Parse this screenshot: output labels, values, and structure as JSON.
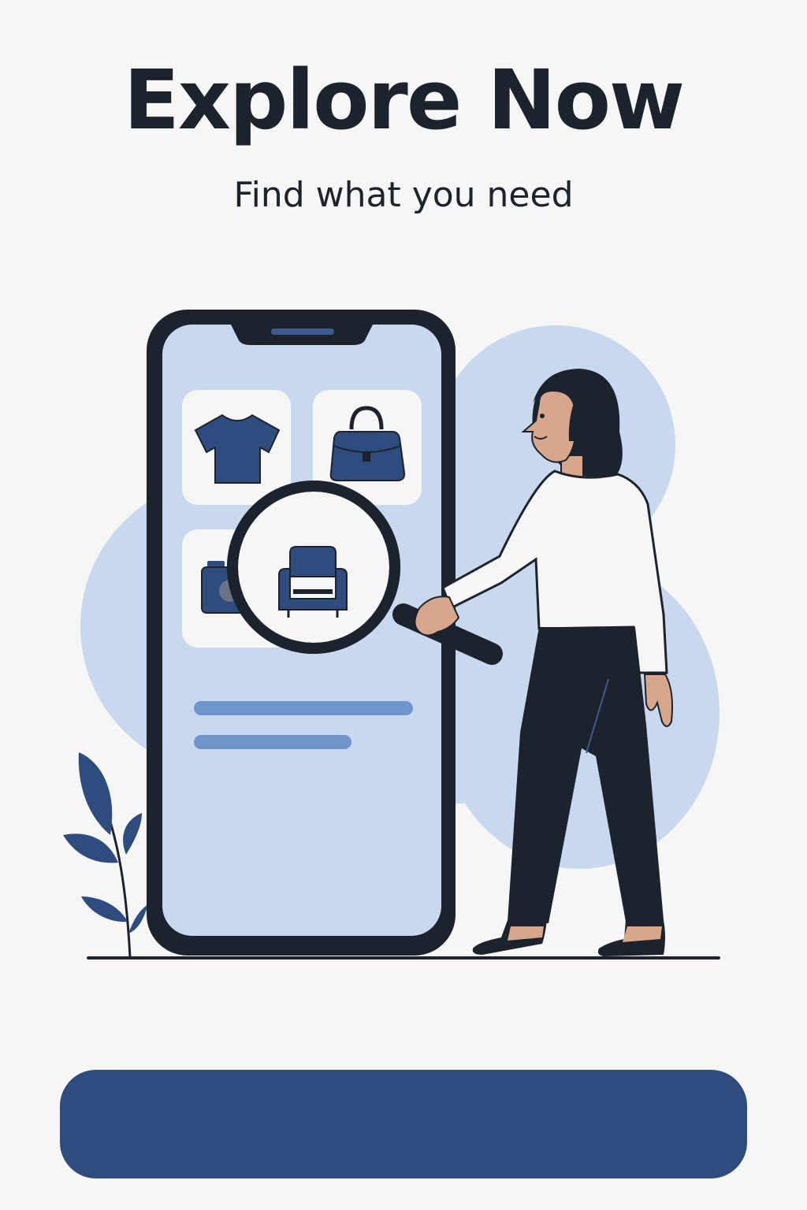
{
  "onboarding": {
    "title": "Explore Now",
    "subtitle": "Find what you need"
  },
  "illustration": {
    "tiles": [
      "t-shirt-icon",
      "handbag-icon",
      "camera-icon",
      "armchair-icon"
    ],
    "tool": "magnifying-glass-icon",
    "figure": "woman-figure",
    "decoration": "plant-leaves"
  },
  "colors": {
    "background": "#f6f6f6",
    "primary": "#2f4c7f",
    "text": "#1d232d",
    "phone_screen": "#c8d9ef",
    "accent_line": "#6f94cc",
    "bg_blob": "#c8d9ef"
  }
}
